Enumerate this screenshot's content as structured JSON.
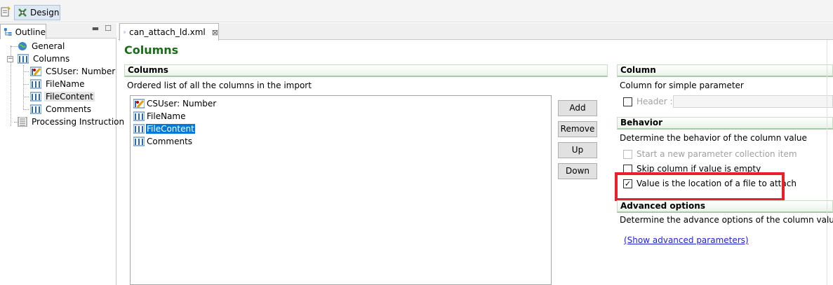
{
  "toolbar": {
    "design_label": "Design"
  },
  "outline": {
    "tab_label": "Outline",
    "tree": {
      "general": "General",
      "columns": "Columns",
      "children": [
        "CSUser: Number",
        "FileName",
        "FileContent",
        "Comments"
      ],
      "processing": "Processing Instruction"
    }
  },
  "editor": {
    "file_tab": "can_attach_ld.xml",
    "page_title": "Columns"
  },
  "columns_section": {
    "title": "Columns",
    "description": "Ordered list of all the columns in the import",
    "items": [
      "CSUser: Number",
      "FileName",
      "FileContent",
      "Comments"
    ],
    "selected_index": 2,
    "buttons": {
      "add": "Add",
      "remove": "Remove",
      "up": "Up",
      "down": "Down"
    }
  },
  "column_section": {
    "title": "Column",
    "description": "Column for simple parameter",
    "header_label": "Header :",
    "header_checked": false
  },
  "behavior_section": {
    "title": "Behavior",
    "description": "Determine the behavior of the column value",
    "options": [
      {
        "label": "Start a new parameter collection item",
        "checked": false,
        "disabled": true
      },
      {
        "label": "Skip column if value is empty",
        "checked": false,
        "disabled": false
      },
      {
        "label": "Value is the location of a file to attach",
        "checked": true,
        "disabled": false
      }
    ]
  },
  "advanced_section": {
    "title": "Advanced options",
    "description": "Determine the advance options of the column value",
    "link": "(Show advanced parameters)"
  },
  "colors": {
    "title_green": "#1a6b1a",
    "selection": "#0078d7",
    "highlight": "#e8202a",
    "link": "#1e1ed2"
  }
}
